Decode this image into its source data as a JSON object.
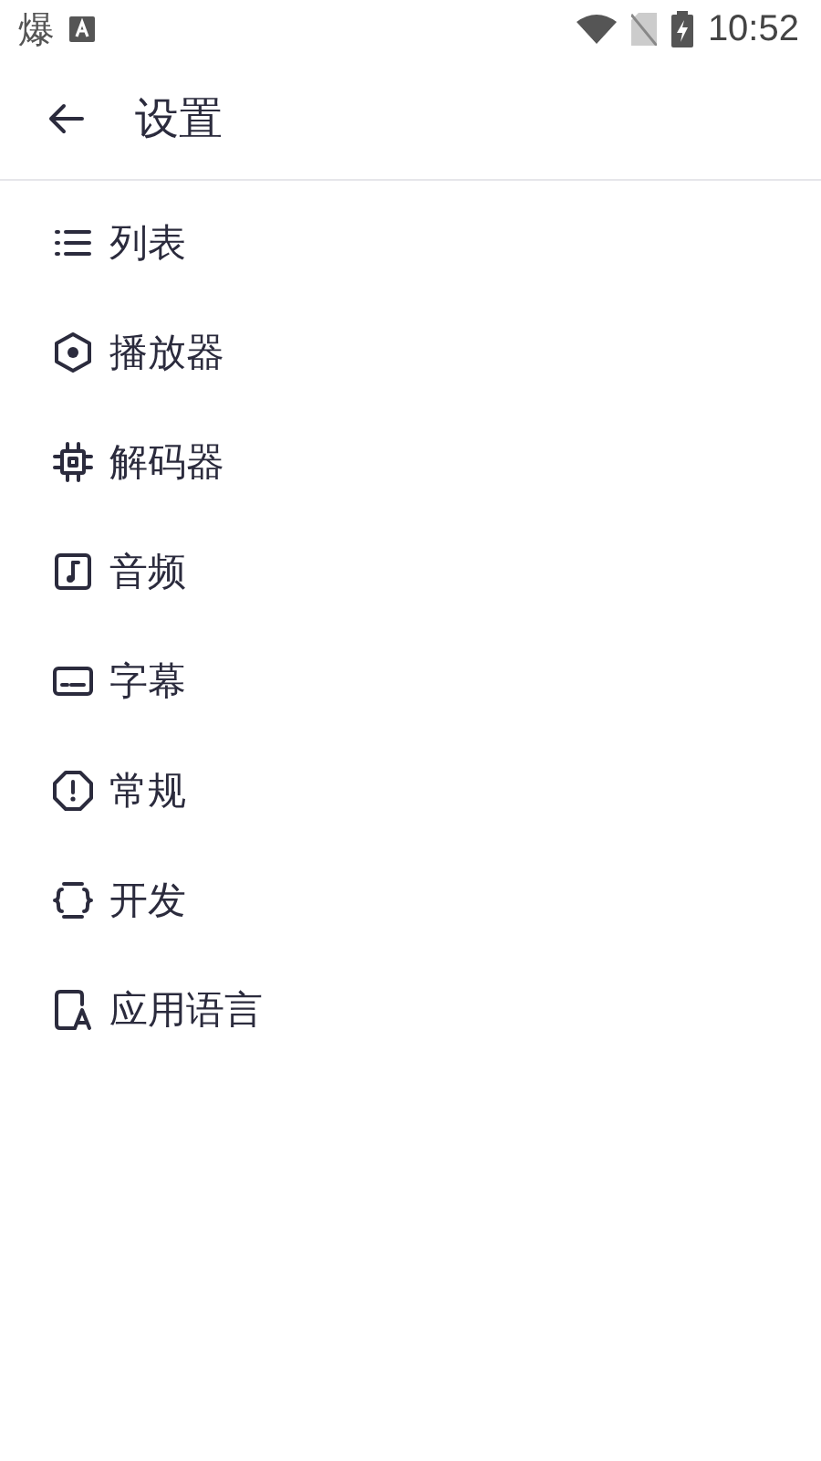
{
  "status_bar": {
    "notification_glyph": "爆",
    "time": "10:52"
  },
  "toolbar": {
    "title": "设置"
  },
  "menu": [
    {
      "kind": "list",
      "label": "列表"
    },
    {
      "kind": "player",
      "label": "播放器"
    },
    {
      "kind": "decoder",
      "label": "解码器"
    },
    {
      "kind": "audio",
      "label": "音频"
    },
    {
      "kind": "subtitle",
      "label": "字幕"
    },
    {
      "kind": "general",
      "label": "常规"
    },
    {
      "kind": "developer",
      "label": "开发"
    },
    {
      "kind": "language",
      "label": "应用语言"
    }
  ]
}
